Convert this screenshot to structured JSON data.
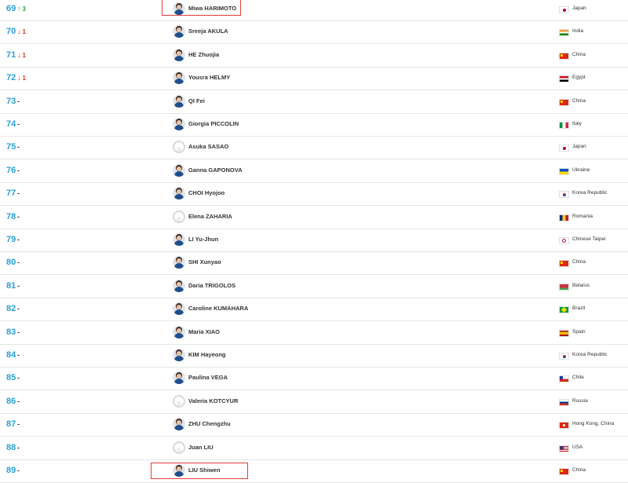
{
  "colors": {
    "rank": "#2a9fd6",
    "up": "#27a844",
    "down": "#e0312a",
    "highlight": "#e53b3b",
    "divider": "#e6e6e6"
  },
  "icons": {
    "up": "arrow-up-icon",
    "down": "arrow-down-icon",
    "unchanged": "dash-icon"
  },
  "rows": [
    {
      "rank": "69",
      "change": {
        "dir": "up",
        "arrow": "↑",
        "amount": "3"
      },
      "name": "Miwa HARIMOTO",
      "photo": true,
      "country": "Japan",
      "flag": "japan",
      "highlighted": true
    },
    {
      "rank": "70",
      "change": {
        "dir": "down",
        "arrow": "↓",
        "amount": "1"
      },
      "name": "Sreeja AKULA",
      "photo": true,
      "country": "India",
      "flag": "india",
      "highlighted": false
    },
    {
      "rank": "71",
      "change": {
        "dir": "down",
        "arrow": "↓",
        "amount": "1"
      },
      "name": "HE Zhuojia",
      "photo": true,
      "country": "China",
      "flag": "china",
      "highlighted": false
    },
    {
      "rank": "72",
      "change": {
        "dir": "down",
        "arrow": "↓",
        "amount": "1"
      },
      "name": "Yousra HELMY",
      "photo": true,
      "country": "Egypt",
      "flag": "egypt",
      "highlighted": false
    },
    {
      "rank": "73",
      "change": {
        "dir": "same",
        "arrow": "-",
        "amount": ""
      },
      "name": "QI Fei",
      "photo": true,
      "country": "China",
      "flag": "china",
      "highlighted": false
    },
    {
      "rank": "74",
      "change": {
        "dir": "same",
        "arrow": "-",
        "amount": ""
      },
      "name": "Giorgia PICCOLIN",
      "photo": true,
      "country": "Italy",
      "flag": "italy",
      "highlighted": false
    },
    {
      "rank": "75",
      "change": {
        "dir": "same",
        "arrow": "-",
        "amount": ""
      },
      "name": "Asuka SASAO",
      "photo": false,
      "country": "Japan",
      "flag": "japan",
      "highlighted": false
    },
    {
      "rank": "76",
      "change": {
        "dir": "same",
        "arrow": "-",
        "amount": ""
      },
      "name": "Ganna GAPONOVA",
      "photo": true,
      "country": "Ukraine",
      "flag": "ukraine",
      "highlighted": false
    },
    {
      "rank": "77",
      "change": {
        "dir": "same",
        "arrow": "-",
        "amount": ""
      },
      "name": "CHOI Hyojoo",
      "photo": true,
      "country": "Korea Republic",
      "flag": "korea",
      "highlighted": false
    },
    {
      "rank": "78",
      "change": {
        "dir": "same",
        "arrow": "-",
        "amount": ""
      },
      "name": "Elena ZAHARIA",
      "photo": false,
      "country": "Romania",
      "flag": "romania",
      "highlighted": false
    },
    {
      "rank": "79",
      "change": {
        "dir": "same",
        "arrow": "-",
        "amount": ""
      },
      "name": "LI Yu-Jhun",
      "photo": true,
      "country": "Chinese Taipei",
      "flag": "taipei",
      "highlighted": false
    },
    {
      "rank": "80",
      "change": {
        "dir": "same",
        "arrow": "-",
        "amount": ""
      },
      "name": "SHI Xunyao",
      "photo": true,
      "country": "China",
      "flag": "china",
      "highlighted": false
    },
    {
      "rank": "81",
      "change": {
        "dir": "same",
        "arrow": "-",
        "amount": ""
      },
      "name": "Daria TRIGOLOS",
      "photo": true,
      "country": "Belarus",
      "flag": "belarus",
      "highlighted": false
    },
    {
      "rank": "82",
      "change": {
        "dir": "same",
        "arrow": "-",
        "amount": ""
      },
      "name": "Caroline KUMAHARA",
      "photo": true,
      "country": "Brazil",
      "flag": "brazil",
      "highlighted": false
    },
    {
      "rank": "83",
      "change": {
        "dir": "same",
        "arrow": "-",
        "amount": ""
      },
      "name": "Maria XIAO",
      "photo": true,
      "country": "Spain",
      "flag": "spain",
      "highlighted": false
    },
    {
      "rank": "84",
      "change": {
        "dir": "same",
        "arrow": "-",
        "amount": ""
      },
      "name": "KIM Hayeong",
      "photo": true,
      "country": "Korea Republic",
      "flag": "korea",
      "highlighted": false
    },
    {
      "rank": "85",
      "change": {
        "dir": "same",
        "arrow": "-",
        "amount": ""
      },
      "name": "Paulina VEGA",
      "photo": true,
      "country": "Chile",
      "flag": "chile",
      "highlighted": false
    },
    {
      "rank": "86",
      "change": {
        "dir": "same",
        "arrow": "-",
        "amount": ""
      },
      "name": "Valeria KOTCYUR",
      "photo": false,
      "country": "Russia",
      "flag": "russia",
      "highlighted": false
    },
    {
      "rank": "87",
      "change": {
        "dir": "same",
        "arrow": "-",
        "amount": ""
      },
      "name": "ZHU Chengzhu",
      "photo": true,
      "country": "Hong Kong, China",
      "flag": "hongkong",
      "highlighted": false
    },
    {
      "rank": "88",
      "change": {
        "dir": "same",
        "arrow": "-",
        "amount": ""
      },
      "name": "Juan LIU",
      "photo": false,
      "country": "USA",
      "flag": "usa",
      "highlighted": false
    },
    {
      "rank": "89",
      "change": {
        "dir": "same",
        "arrow": "-",
        "amount": ""
      },
      "name": "LIU Shiwen",
      "photo": true,
      "country": "China",
      "flag": "china",
      "highlighted": true
    }
  ]
}
